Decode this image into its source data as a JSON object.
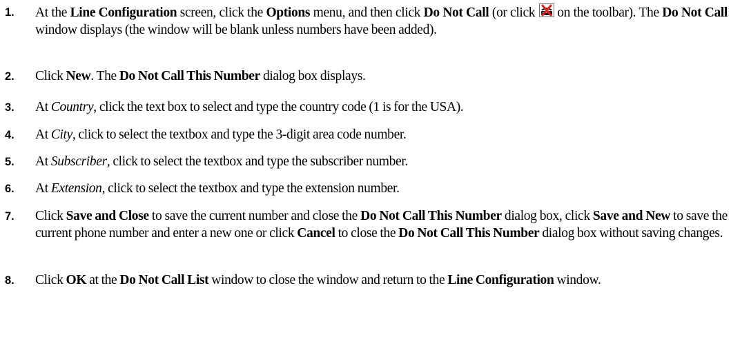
{
  "steps": [
    {
      "number": "1.",
      "parts": {
        "a": "At the ",
        "b": "Line Configuration",
        "c": " screen, click the ",
        "d": "Options",
        "e": " menu, and then click ",
        "f": "Do Not Call",
        "g": " (or click ",
        "h": " on the toolbar).  The ",
        "i": "Do Not Call",
        "j": " window displays (the window will be blank unless numbers have been added)."
      },
      "toolbar_icon": "do-not-call-icon"
    },
    {
      "number": "2.",
      "parts": {
        "a": "Click ",
        "b": "New",
        "c": ".  The ",
        "d": "Do Not Call This Number",
        "e": " dialog box displays."
      }
    },
    {
      "number": "3.",
      "parts": {
        "a": "At ",
        "b": "Country",
        "c": ", click the text box to select and type the country code (1 is for the USA)."
      }
    },
    {
      "number": "4.",
      "parts": {
        "a": "At ",
        "b": "City",
        "c": ", click to select the textbox and type the 3-digit area code number."
      }
    },
    {
      "number": "5.",
      "parts": {
        "a": "At ",
        "b": "Subscriber",
        "c": ", click to select the textbox and type the subscriber number."
      }
    },
    {
      "number": "6.",
      "parts": {
        "a": "At ",
        "b": "Extension",
        "c": ", click to select the textbox and type the extension number."
      }
    },
    {
      "number": "7.",
      "parts": {
        "a": "Click ",
        "b": "Save and Close",
        "c": " to save the current number and close the ",
        "d": "Do Not Call This Number",
        "e": " dialog box, click ",
        "f": "Save and New",
        "g": " to save the current phone number and enter a new one or click ",
        "h": "Cancel",
        "i": " to close the ",
        "j": "Do Not Call This Number",
        "k": " dialog box without saving changes."
      }
    },
    {
      "number": "8.",
      "parts": {
        "a": "Click ",
        "b": "OK",
        "c": " at the ",
        "d": "Do Not Call List",
        "e": " window to close the window and return to the ",
        "f": "Line Configuration",
        "g": " window."
      }
    }
  ]
}
